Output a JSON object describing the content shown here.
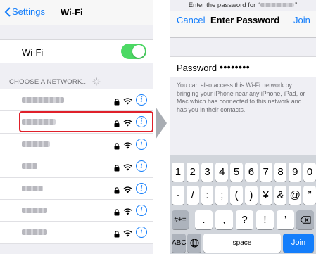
{
  "left_screen": {
    "back_label": "Settings",
    "title": "Wi-Fi",
    "wifi_label": "Wi-Fi",
    "wifi_enabled": true,
    "section_header": "CHOOSE A NETWORK...",
    "networks": [
      {
        "name_width": 60
      },
      {
        "name_width": 48
      },
      {
        "name_width": 40
      },
      {
        "name_width": 22
      },
      {
        "name_width": 30
      },
      {
        "name_width": 36
      },
      {
        "name_width": 36
      }
    ]
  },
  "right_screen": {
    "prompt_prefix": "Enter the password for “",
    "prompt_suffix": "”",
    "cancel_label": "Cancel",
    "title": "Enter Password",
    "join_label": "Join",
    "password_label": "Password",
    "password_value": "••••••••",
    "help_text": "You can also access this Wi-Fi network by bringing your iPhone near any iPhone, iPad, or Mac which has connected to this network and has you in their contacts.",
    "keyboard": {
      "row1": [
        "1",
        "2",
        "3",
        "4",
        "5",
        "6",
        "7",
        "8",
        "9",
        "0"
      ],
      "row2": [
        "-",
        "/",
        ":",
        ";",
        "(",
        ")",
        "¥",
        "&",
        "@",
        "”"
      ],
      "row3_left": "#+=",
      "row3": [
        ".",
        ",",
        "?",
        "!",
        "’"
      ],
      "abc_label": "ABC",
      "space_label": "space",
      "join_label": "Join"
    }
  },
  "colors": {
    "accent": "#147efb",
    "toggle_on": "#4cd964",
    "highlight": "#e0202a",
    "keyboard_bg": "#d1d5db"
  }
}
